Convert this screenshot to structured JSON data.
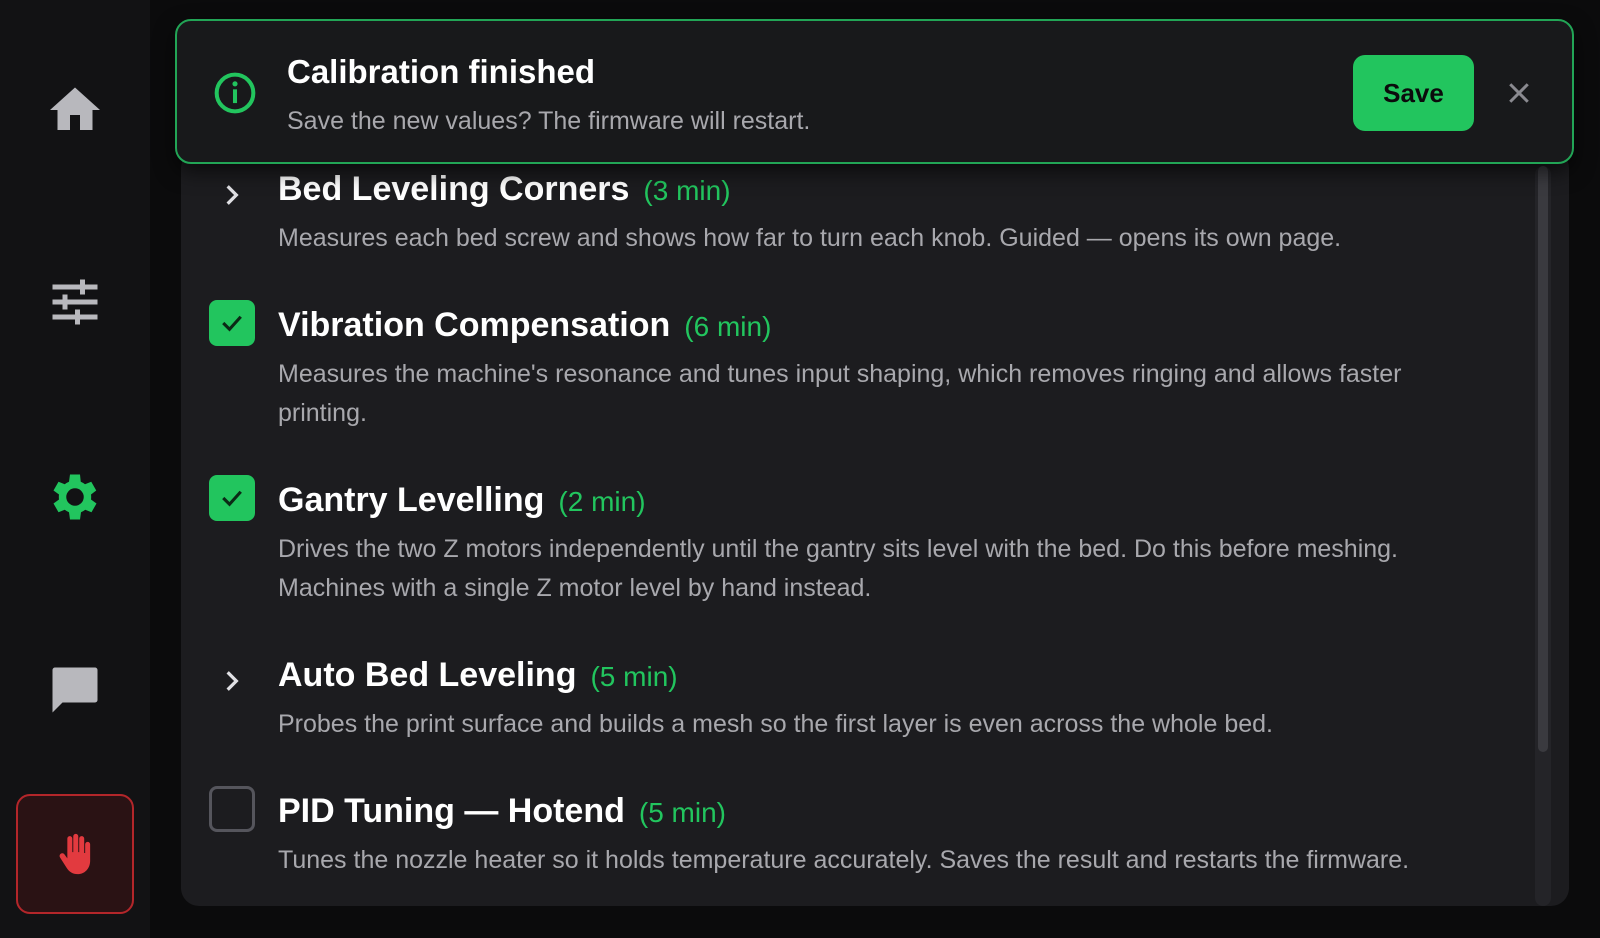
{
  "nav": {
    "items": [
      {
        "icon": "home-icon",
        "active": false
      },
      {
        "icon": "sliders-icon",
        "active": false
      },
      {
        "icon": "gear-icon",
        "active": true
      },
      {
        "icon": "chat-icon",
        "active": false
      }
    ],
    "estop_icon": "hand-stop-icon"
  },
  "colors": {
    "accent": "#22c55e",
    "muted": "#a8a8ad",
    "danger": "#e23a3f"
  },
  "toast": {
    "title": "Calibration finished",
    "message": "Save the new values? The firmware will restart.",
    "save_label": "Save",
    "icon": "info-icon",
    "close_icon": "close-icon"
  },
  "calibrations": [
    {
      "title": "Bed Leveling Corners",
      "duration": "(3 min)",
      "state": "expand",
      "description": "Measures each bed screw and shows how far to turn each knob. Guided — opens its own page."
    },
    {
      "title": "Vibration Compensation",
      "duration": "(6 min)",
      "state": "checked",
      "description": "Measures the machine's resonance and tunes input shaping, which removes ringing and allows faster printing."
    },
    {
      "title": "Gantry Levelling",
      "duration": "(2 min)",
      "state": "checked",
      "description": "Drives the two Z motors independently until the gantry sits level with the bed. Do this before meshing. Machines with a single Z motor level by hand instead."
    },
    {
      "title": "Auto Bed Leveling",
      "duration": "(5 min)",
      "state": "expand",
      "description": "Probes the print surface and builds a mesh so the first layer is even across the whole bed."
    },
    {
      "title": "PID Tuning — Hotend",
      "duration": "(5 min)",
      "state": "unchecked",
      "description": "Tunes the nozzle heater so it holds temperature accurately. Saves the result and restarts the firmware."
    }
  ]
}
